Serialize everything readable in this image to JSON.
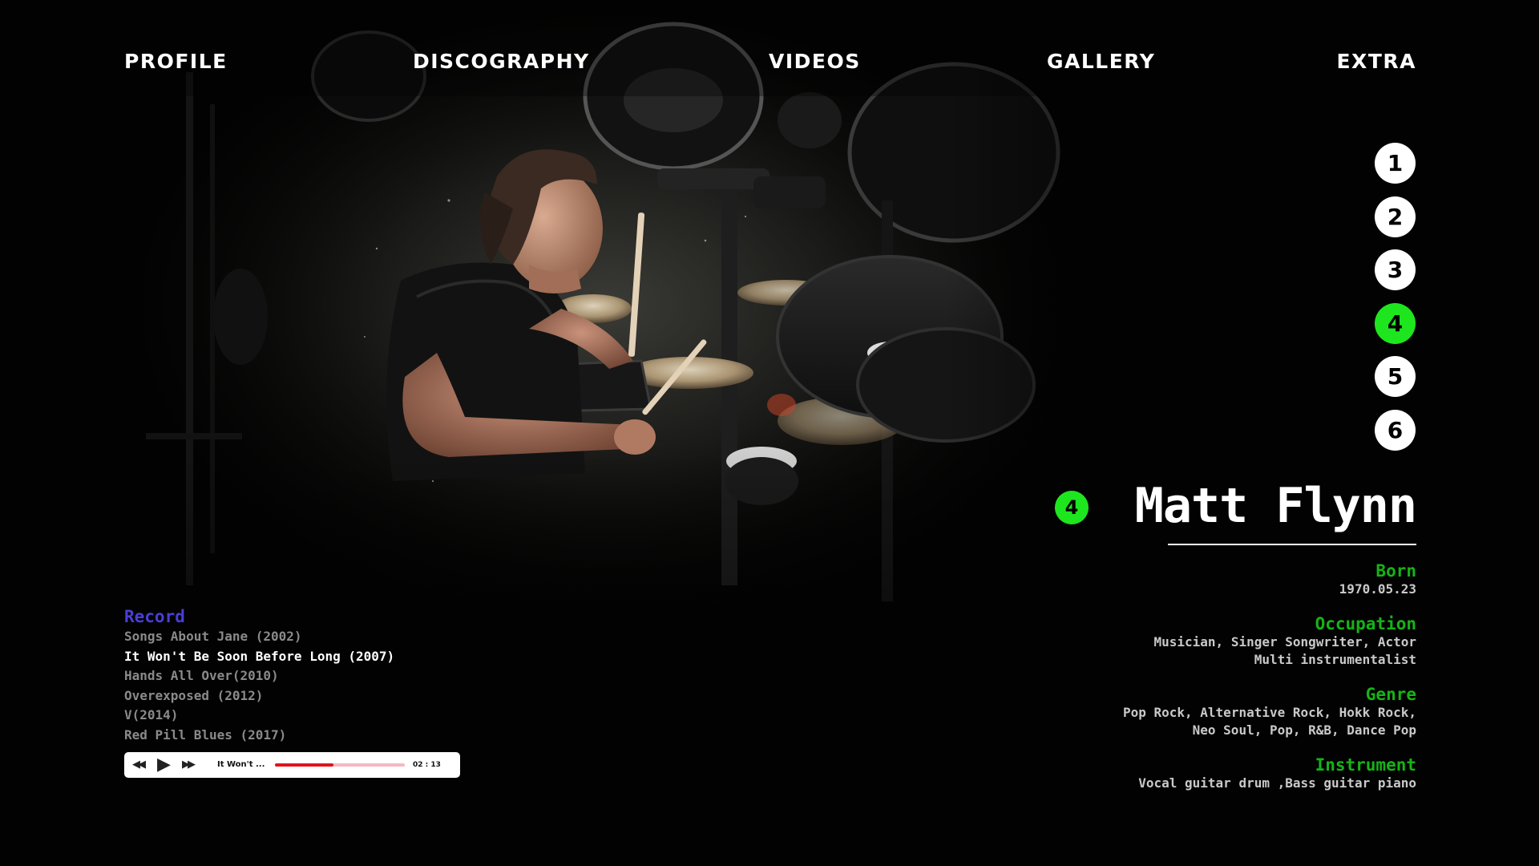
{
  "nav": {
    "items": [
      "PROFILE",
      "DISCOGRAPHY",
      "VIDEOS",
      "GALLERY",
      "EXTRA"
    ]
  },
  "members": {
    "numbers": [
      "1",
      "2",
      "3",
      "4",
      "5",
      "6"
    ],
    "selected": "4"
  },
  "profile": {
    "badge": "4",
    "name": "Matt Flynn",
    "born_label": "Born",
    "born_value": "1970.05.23",
    "occupation_label": "Occupation",
    "occupation_lines": [
      "Musician, Singer Songwriter, Actor",
      "Multi instrumentalist"
    ],
    "genre_label": "Genre",
    "genre_lines": [
      "Pop Rock, Alternative Rock, Hokk Rock,",
      "Neo Soul, Pop, R&B, Dance Pop"
    ],
    "instrument_label": "Instrument",
    "instrument_value": "Vocal guitar drum ,Bass guitar piano"
  },
  "records": {
    "title": "Record",
    "items": [
      "Songs About Jane (2002)",
      "It Won't Be Soon Before Long (2007)",
      "Hands All Over(2010)",
      "Overexposed (2012)",
      "V(2014)",
      "Red Pill Blues (2017)"
    ],
    "active_index": 1
  },
  "player": {
    "prev_icon": "rewind-icon",
    "play_icon": "play-icon",
    "next_icon": "fast-forward-icon",
    "track_title": "It Won't ...",
    "time": "02 : 13",
    "progress": 0.45
  },
  "colors": {
    "accent_green": "#1ee61e",
    "label_green": "#16b316",
    "record_title_blue": "#4a3ed6",
    "progress_red": "#e0141e"
  }
}
